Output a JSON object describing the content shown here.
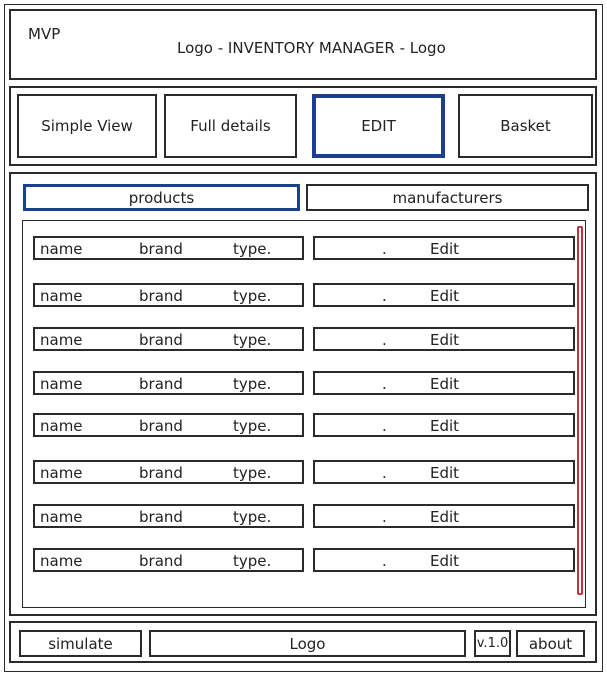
{
  "header": {
    "mvp": "MVP",
    "title": "Logo - INVENTORY MANAGER - Logo"
  },
  "toolbar": {
    "simple_view": "Simple View",
    "full_details": "Full details",
    "edit": "EDIT",
    "basket": "Basket"
  },
  "tabs": {
    "products": "products",
    "manufacturers": "manufacturers"
  },
  "rows": [
    {
      "name": "name",
      "brand": "brand",
      "type": "type.",
      "dot": ".",
      "action": "Edit"
    },
    {
      "name": "name",
      "brand": "brand",
      "type": "type.",
      "dot": ".",
      "action": "Edit"
    },
    {
      "name": "name",
      "brand": "brand",
      "type": "type.",
      "dot": ".",
      "action": "Edit"
    },
    {
      "name": "name",
      "brand": "brand",
      "type": "type.",
      "dot": ".",
      "action": "Edit"
    },
    {
      "name": "name",
      "brand": "brand",
      "type": "type.",
      "dot": ".",
      "action": "Edit"
    },
    {
      "name": "name",
      "brand": "brand",
      "type": "type.",
      "dot": ".",
      "action": "Edit"
    },
    {
      "name": "name",
      "brand": "brand",
      "type": "type.",
      "dot": ".",
      "action": "Edit"
    },
    {
      "name": "name",
      "brand": "brand",
      "type": "type.",
      "dot": ".",
      "action": "Edit"
    }
  ],
  "footer": {
    "simulate": "simulate",
    "logo": "Logo",
    "version": "v.1.0",
    "about": "about"
  },
  "colors": {
    "selected_border": "#1d3f8f",
    "scrollbar": "#c9303f"
  }
}
